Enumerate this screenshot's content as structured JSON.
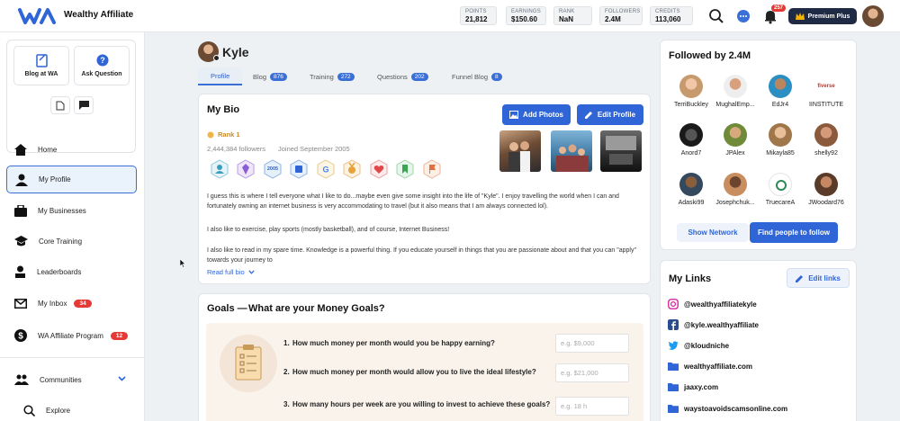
{
  "brand": {
    "logo": "WA",
    "name": "Wealthy Affiliate"
  },
  "stats": [
    {
      "label": "POINTS",
      "value": "21,812"
    },
    {
      "label": "EARNINGS",
      "value": "$150.60"
    },
    {
      "label": "RANK",
      "value": "NaN"
    },
    {
      "label": "FOLLOWERS",
      "value": "2.4M"
    },
    {
      "label": "CREDITS",
      "value": "113,060"
    }
  ],
  "notifications": {
    "count": "257"
  },
  "premium": {
    "label": "Premium Plus"
  },
  "quick": {
    "blog": "Blog at WA",
    "ask": "Ask Question"
  },
  "nav": [
    {
      "label": "Home"
    },
    {
      "label": "My Profile"
    },
    {
      "label": "My Businesses"
    },
    {
      "label": "Core Training"
    },
    {
      "label": "Leaderboards"
    },
    {
      "label": "My Inbox",
      "count": "34"
    },
    {
      "label": "WA Affiliate Program",
      "count": "12"
    },
    {
      "label": "Communities"
    },
    {
      "label": "Explore"
    }
  ],
  "profile": {
    "name": "Kyle",
    "tabs": [
      {
        "label": "Profile"
      },
      {
        "label": "Blog",
        "count": "876"
      },
      {
        "label": "Training",
        "count": "272"
      },
      {
        "label": "Questions",
        "count": "202"
      },
      {
        "label": "Funnel Blog",
        "count": "8"
      }
    ]
  },
  "bio": {
    "title": "My Bio",
    "add_photos": "Add Photos",
    "edit_profile": "Edit Profile",
    "rank": "Rank 1",
    "followers": "2,444,384 followers",
    "joined": "Joined September 2005",
    "badge_year": "2005",
    "p1": "I guess this is where I tell everyone what I like to do...maybe even give some insight into the life of \"Kyle\". I enjoy travelling the world when I can and fortunately owning an internet business is very accommodating to travel (but it also means that I am always connected lol).",
    "p2": "I also like to exercise, play sports (mostly basketball), and of course, Internet Business!",
    "p3": "I also like to read in my spare time. Knowledge is a powerful thing. If you educate yourself in things that you are passionate about and that you can \"apply\" towards your journey to",
    "read_more": "Read full bio"
  },
  "goals": {
    "title": "Goals —",
    "subtitle": "What are your Money Goals?",
    "questions": [
      {
        "num": "1.",
        "text": "How much money per month would you be happy earning?",
        "placeholder": "e.g. $9,000"
      },
      {
        "num": "2.",
        "text": "How much money per month would allow you to live the ideal lifestyle?",
        "placeholder": "e.g. $21,000"
      },
      {
        "num": "3.",
        "text": "How many hours per week are you willing to invest to achieve these goals?",
        "placeholder": "e.g. 18 h"
      }
    ]
  },
  "followed": {
    "title": "Followed by 2.4M",
    "users": [
      "TerriBuckley",
      "MughalEmp...",
      "EdJr4",
      "IINSTITUTE",
      "Anord7",
      "JPAlex",
      "Mikayla85",
      "shelly92",
      "Adaski99",
      "Josephchuk...",
      "TruecareA",
      "JWoodard76"
    ],
    "show_network": "Show Network",
    "find_people": "Find people to follow",
    "logo_text": "fiverse"
  },
  "links": {
    "title": "My Links",
    "edit": "Edit links",
    "items": [
      "@wealthyaffiliatekyle",
      "@kyle.wealthyaffiliate",
      "@kloudniche",
      "wealthyaffiliate.com",
      "jaaxy.com",
      "waystoavoidscamsonline.com"
    ]
  }
}
